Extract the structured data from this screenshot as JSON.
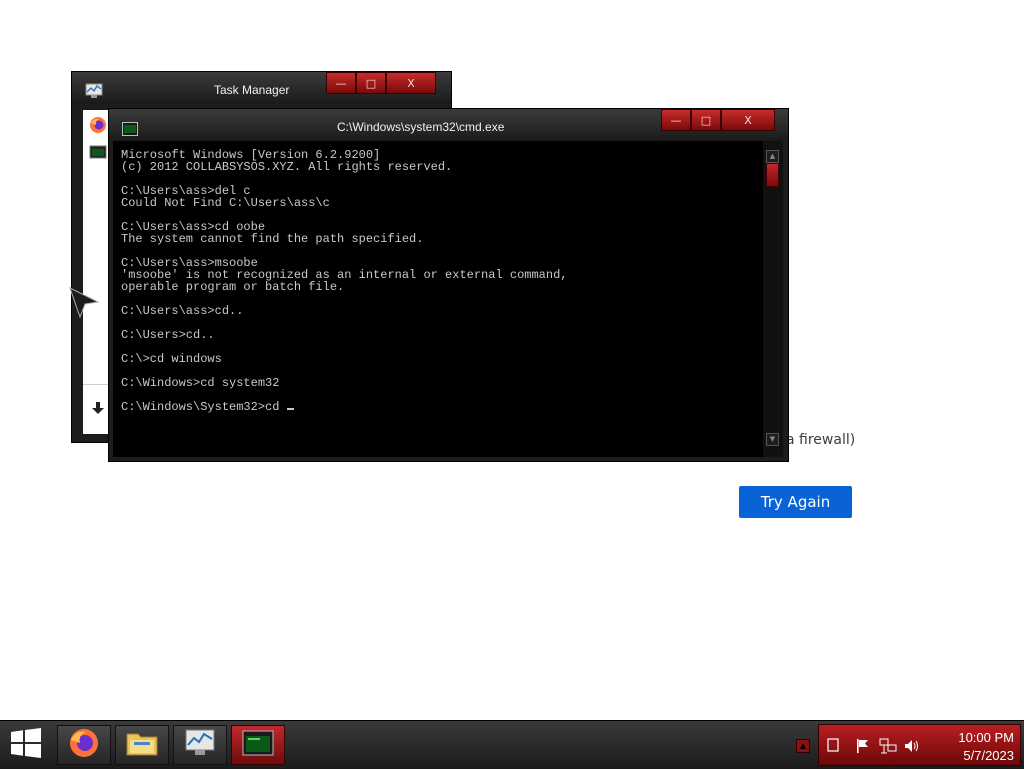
{
  "browser_page": {
    "fragment_text": "a firewall)",
    "try_again_label": "Try Again"
  },
  "task_manager": {
    "title": "Task Manager",
    "rows": [
      {
        "icon": "firefox-icon"
      },
      {
        "icon": "terminal-icon"
      }
    ],
    "more_details_icon": "down-arrow-icon",
    "controls": {
      "minimize": "—",
      "maximize": "□",
      "close": "X"
    }
  },
  "cmd": {
    "title": "C:\\Windows\\system32\\cmd.exe",
    "controls": {
      "minimize": "—",
      "maximize": "□",
      "close": "X"
    },
    "lines": [
      "Microsoft Windows [Version 6.2.9200]",
      "(c) 2012 COLLABSYSOS.XYZ. All rights reserved.",
      "",
      "C:\\Users\\ass>del c",
      "Could Not Find C:\\Users\\ass\\c",
      "",
      "C:\\Users\\ass>cd oobe",
      "The system cannot find the path specified.",
      "",
      "C:\\Users\\ass>msoobe",
      "'msoobe' is not recognized as an internal or external command,",
      "operable program or batch file.",
      "",
      "C:\\Users\\ass>cd..",
      "",
      "C:\\Users>cd..",
      "",
      "C:\\>cd windows",
      "",
      "C:\\Windows>cd system32",
      ""
    ],
    "prompt": "C:\\Windows\\System32>cd "
  },
  "taskbar": {
    "start_icon": "windows-logo-icon",
    "buttons": [
      {
        "name": "firefox",
        "icon": "firefox-icon"
      },
      {
        "name": "file-explorer",
        "icon": "folder-icon"
      },
      {
        "name": "task-manager",
        "icon": "task-manager-icon"
      },
      {
        "name": "command-prompt",
        "icon": "terminal-icon",
        "active": true
      }
    ],
    "tray_icons": [
      "show-desktop-icon",
      "flag-icon",
      "network-icon",
      "volume-icon"
    ],
    "time": "10:00 PM",
    "date": "5/7/2023"
  },
  "colors": {
    "accent_red": "#c0292d",
    "button_blue": "#0a63d6",
    "console_bg": "#000000",
    "console_text": "#c8c8c8"
  }
}
